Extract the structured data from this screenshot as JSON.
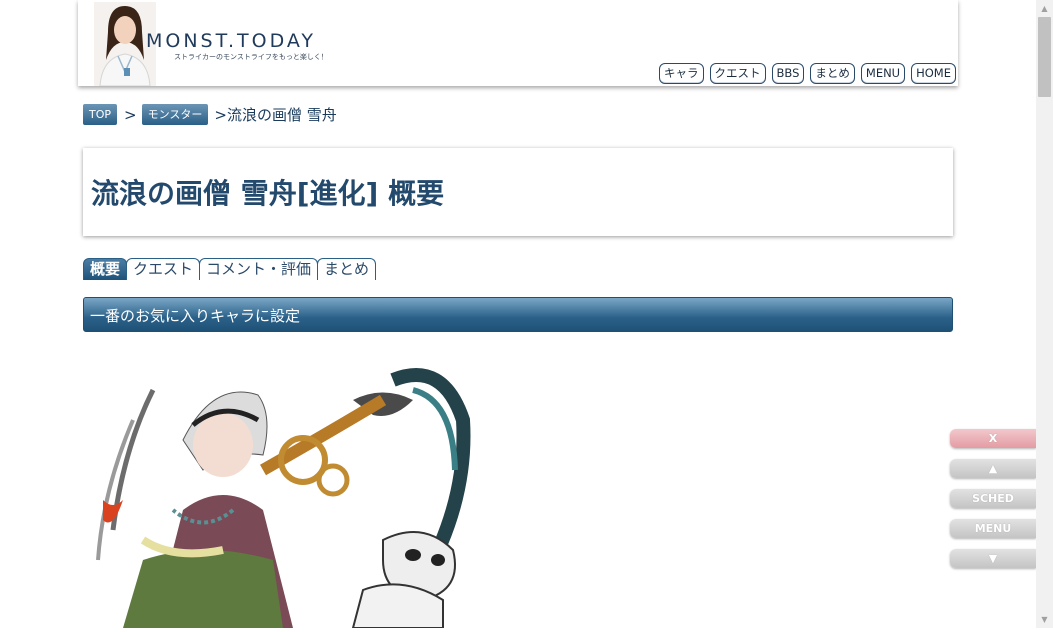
{
  "header": {
    "site_title": "MONST.TODAY",
    "tagline": "ストライカーのモンストライフをもっと楽しく！",
    "nav": [
      "キャラ",
      "クエスト",
      "BBS",
      "まとめ",
      "MENU",
      "HOME"
    ]
  },
  "breadcrumb": {
    "top": "TOP",
    "separator": ">",
    "category": "モンスター",
    "current": ">流浪の画僧 雪舟"
  },
  "page": {
    "title": "流浪の画僧 雪舟[進化] 概要"
  },
  "tabs": [
    {
      "label": "概要",
      "active": true
    },
    {
      "label": "クエスト",
      "active": false
    },
    {
      "label": "コメント・評価",
      "active": false
    },
    {
      "label": "まとめ",
      "active": false
    }
  ],
  "section": {
    "favorite_label": "一番のお気に入りキャラに設定"
  },
  "side_buttons": [
    "X",
    "▲",
    "SCHED",
    "MENU",
    "▼"
  ],
  "scrollbar": {
    "up": "▲",
    "down": "▼"
  },
  "colors": {
    "accent": "#2b6189",
    "title": "#23496d",
    "close_button": "#e39ca3"
  }
}
